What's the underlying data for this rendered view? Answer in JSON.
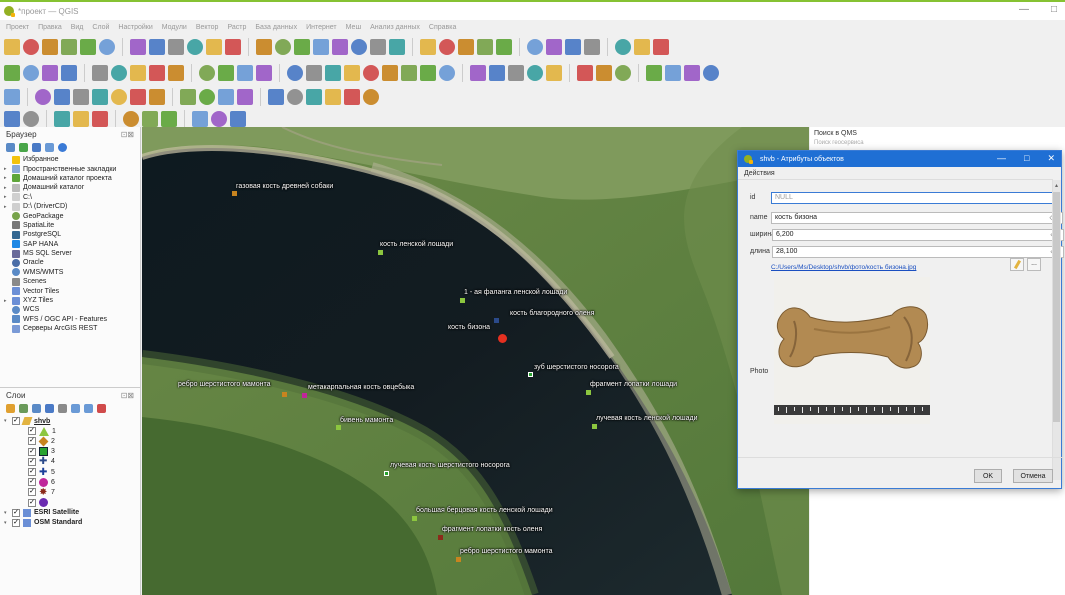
{
  "window": {
    "title": "*проект — QGIS",
    "minimize": "—",
    "maximize": "□"
  },
  "menu": [
    "Проект",
    "Правка",
    "Вид",
    "Слой",
    "Настройки",
    "Модули",
    "Вектор",
    "Растр",
    "База данных",
    "Интернет",
    "Меш",
    "Анализ данных",
    "Справка"
  ],
  "browser": {
    "title": "Браузер",
    "items": [
      {
        "label": "Избранное",
        "icon": "star-icon",
        "color": "#f3c20c",
        "arrow": ""
      },
      {
        "label": "Пространственные закладки",
        "icon": "bookmark-icon",
        "color": "#8aa9d8",
        "arrow": "▸"
      },
      {
        "label": "Домашний каталог проекта",
        "icon": "project-home-icon",
        "color": "#5ea53a",
        "arrow": "▸"
      },
      {
        "label": "Домашний каталог",
        "icon": "home-icon",
        "color": "#bbbbbb",
        "arrow": "▸"
      },
      {
        "label": "C:\\",
        "icon": "drive-icon",
        "color": "#cfcfcf",
        "arrow": "▸"
      },
      {
        "label": "D:\\ (DriverCD)",
        "icon": "drive-icon",
        "color": "#cfcfcf",
        "arrow": "▸"
      },
      {
        "label": "GeoPackage",
        "icon": "geopackage-icon",
        "color": "#77a34a",
        "arrow": ""
      },
      {
        "label": "SpatiaLite",
        "icon": "spatialite-icon",
        "color": "#777777",
        "arrow": ""
      },
      {
        "label": "PostgreSQL",
        "icon": "postgresql-icon",
        "color": "#336791",
        "arrow": ""
      },
      {
        "label": "SAP HANA",
        "icon": "sap-hana-icon",
        "color": "#1e88e5",
        "arrow": ""
      },
      {
        "label": "MS SQL Server",
        "icon": "mssql-icon",
        "color": "#6a6a9a",
        "arrow": ""
      },
      {
        "label": "Oracle",
        "icon": "oracle-icon",
        "color": "#4a6da7",
        "arrow": ""
      },
      {
        "label": "WMS/WMTS",
        "icon": "wms-icon",
        "color": "#5a8ac6",
        "arrow": ""
      },
      {
        "label": "Scenes",
        "icon": "scenes-icon",
        "color": "#8a8a8a",
        "arrow": ""
      },
      {
        "label": "Vector Tiles",
        "icon": "vector-tiles-icon",
        "color": "#6b8fd6",
        "arrow": ""
      },
      {
        "label": "XYZ Tiles",
        "icon": "xyz-tiles-icon",
        "color": "#6b8fd6",
        "arrow": "▸"
      },
      {
        "label": "WCS",
        "icon": "wcs-icon",
        "color": "#5a8ac6",
        "arrow": ""
      },
      {
        "label": "WFS / OGC API - Features",
        "icon": "wfs-icon",
        "color": "#5a8ac6",
        "arrow": ""
      },
      {
        "label": "Серверы ArcGIS REST",
        "icon": "arcgis-icon",
        "color": "#7a9ad6",
        "arrow": ""
      }
    ]
  },
  "layers": {
    "title": "Слои",
    "group": "shvb",
    "classes": [
      {
        "label": "1",
        "icon": "triangle-icon",
        "color": "#8cc63f"
      },
      {
        "label": "2",
        "icon": "diamond-icon",
        "color": "#c8841f"
      },
      {
        "label": "3",
        "icon": "square-icon",
        "color": "#27a22f"
      },
      {
        "label": "4",
        "icon": "cross-icon",
        "color": "#2b4a8a"
      },
      {
        "label": "5",
        "icon": "plus-icon",
        "color": "#1b3f9a"
      },
      {
        "label": "6",
        "icon": "circle-icon",
        "color": "#c0269a"
      },
      {
        "label": "7",
        "icon": "star-marker-icon",
        "color": "#8b2a1a"
      },
      {
        "label": "",
        "icon": "dot-icon",
        "color": "#6a2ab0"
      }
    ],
    "basemaps": [
      "ESRI Satellite",
      "OSM Standard"
    ]
  },
  "map_labels": [
    {
      "text": "газовая кость древней собаки"
    },
    {
      "text": "кость ленской лошади"
    },
    {
      "text": "1 - ая фаланга ленской лошади"
    },
    {
      "text": "кость благородного оленя"
    },
    {
      "text": "кость бизона"
    },
    {
      "text": "зуб шерстистого носорога"
    },
    {
      "text": "фрагмент лопатки лошади"
    },
    {
      "text": "ребро шерстистого мамонта"
    },
    {
      "text": "метакарпальная кость овцебыка"
    },
    {
      "text": "бивень мамонта"
    },
    {
      "text": "лучевая кость ленской лошади"
    },
    {
      "text": "лучевая кость шерстистого носорога"
    },
    {
      "text": "большая берцовая кость ленской лошади"
    },
    {
      "text": "фрагмент лопатки кость оленя"
    },
    {
      "text": "ребро шерстистого мамонта"
    }
  ],
  "qms": {
    "title": "Поиск в QMS",
    "subtitle": "Поиск геосервиса"
  },
  "dialog": {
    "title": "shvb - Атрибуты объектов",
    "actions": "Действия",
    "fields": [
      {
        "label": "id",
        "value": "NULL"
      },
      {
        "label": "name",
        "value": "кость бизона"
      },
      {
        "label": "ширина",
        "value": "6,200"
      },
      {
        "label": "длина",
        "value": "28,100"
      }
    ],
    "path": "C:/Users/Ms/Desktop/shvb/фото/кость бизона.jpg",
    "photo_label": "Photo",
    "ok": "OK",
    "cancel": "Отмена",
    "clear_glyph": "⌫",
    "browse_glyph": "..."
  }
}
